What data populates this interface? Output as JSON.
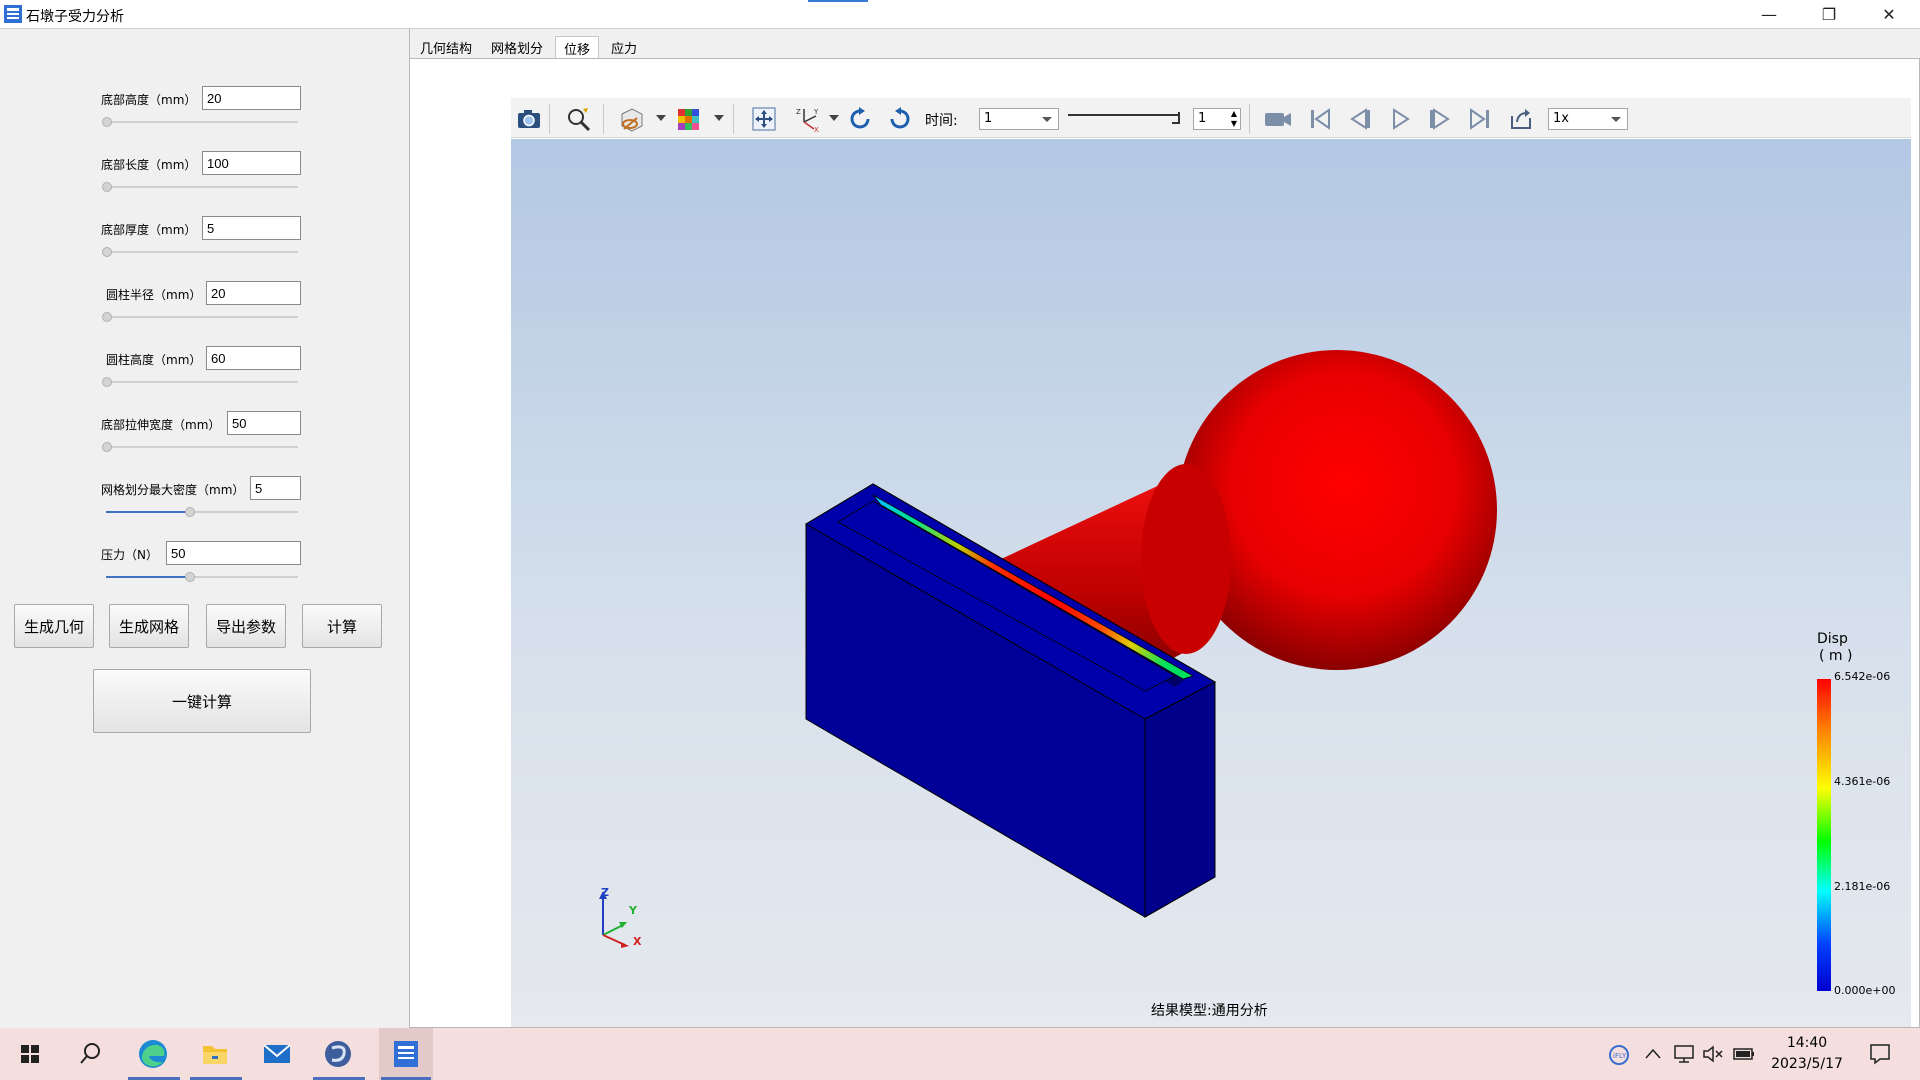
{
  "window": {
    "title": "石墩子受力分析",
    "buttons": {
      "minimize": "—",
      "maximize": "❐",
      "close": "✕"
    }
  },
  "params": [
    {
      "label": "底部高度（mm）",
      "value": "20",
      "slider": 0.0
    },
    {
      "label": "底部长度（mm）",
      "value": "100",
      "slider": 0.0
    },
    {
      "label": "底部厚度（mm）",
      "value": "5",
      "slider": 0.0
    },
    {
      "label": "圆柱半径（mm）",
      "value": "20",
      "slider": 0.0
    },
    {
      "label": "圆柱高度（mm）",
      "value": "60",
      "slider": 0.0
    },
    {
      "label": "底部拉伸宽度（mm）",
      "value": "50",
      "slider": 0.0
    },
    {
      "label": "网格划分最大密度（mm）",
      "value": "5",
      "slider": 0.44
    },
    {
      "label": "压力（N）",
      "value": "50",
      "slider": 0.44
    }
  ],
  "buttons": {
    "gen_geometry": "生成几何",
    "gen_mesh": "生成网格",
    "export_params": "导出参数",
    "compute": "计算",
    "one_click": "一键计算"
  },
  "tabs": [
    "几何结构",
    "网格划分",
    "位移",
    "应力"
  ],
  "active_tab": "位移",
  "toolbar": {
    "time_label": "时间:",
    "time_value": "1",
    "frame_value": "1",
    "speed_value": "1x",
    "icons": [
      "camera-icon",
      "zoom-icon",
      "visibility-icon",
      "color-map-icon",
      "fit-view-icon",
      "axes-icon",
      "rotate-cw-icon",
      "rotate-ccw-icon",
      "record-icon",
      "first-frame-icon",
      "prev-frame-icon",
      "play-icon",
      "next-frame-icon",
      "last-frame-icon",
      "export-icon"
    ]
  },
  "viewport": {
    "caption": "结果模型:通用分析",
    "axes": {
      "x": "X",
      "y": "Y",
      "z": "Z"
    }
  },
  "legend": {
    "title": "Disp",
    "unit": "( m )",
    "ticks": [
      "6.542e-06",
      "4.361e-06",
      "2.181e-06",
      "0.000e+00"
    ],
    "colors": {
      "max": "#ff0000",
      "high": "#ffff00",
      "mid": "#00ff00",
      "low": "#00ffff",
      "min": "#0000d0"
    }
  },
  "taskbar": {
    "time": "14:40",
    "date": "2023/5/17",
    "apps": [
      "windows-start-icon",
      "search-icon",
      "edge-icon",
      "file-explorer-icon",
      "mail-icon",
      "app-swirl-icon",
      "active-app-icon"
    ]
  }
}
